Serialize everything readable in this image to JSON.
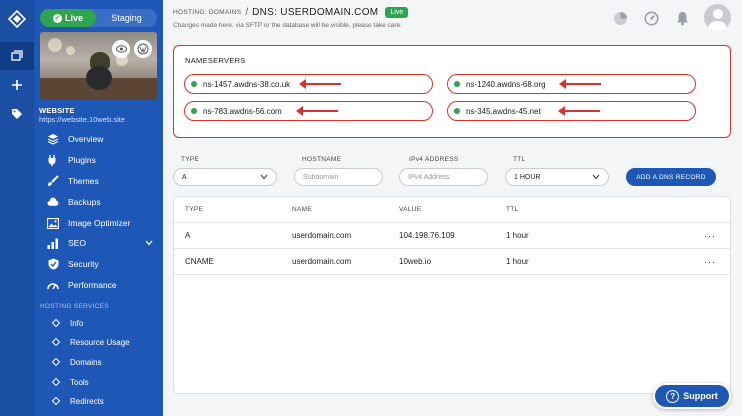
{
  "sidebar": {
    "env_live": "Live",
    "env_staging": "Staging",
    "website_label": "WEBSITE",
    "website_url": "https://website.10web.site",
    "nav": [
      {
        "label": "Overview",
        "icon": "layers-icon"
      },
      {
        "label": "Plugins",
        "icon": "plug-icon"
      },
      {
        "label": "Themes",
        "icon": "brush-icon"
      },
      {
        "label": "Backups",
        "icon": "cloud-icon"
      },
      {
        "label": "Image Optimizer",
        "icon": "image-icon"
      },
      {
        "label": "SEO",
        "icon": "bar-chart-icon"
      },
      {
        "label": "Security",
        "icon": "shield-icon"
      },
      {
        "label": "Performance",
        "icon": "gauge-icon"
      }
    ],
    "hosting_section": "HOSTING SERVICES",
    "hosting": [
      "Info",
      "Resource Usage",
      "Domains",
      "Tools",
      "Redirects"
    ]
  },
  "header": {
    "crumb": "HOSTING: DOMAINS",
    "sep": "/",
    "title": "DNS: USERDOMAIN.COM",
    "badge": "Live",
    "notice": "Changes made here, via SFTP or the database will be visible, please take care."
  },
  "nameservers": {
    "heading": "NAMESERVERS",
    "items": [
      "ns-1457.awdns-38.co.uk",
      "ns-1240.awdns-68.org",
      "ns-783.awdns-56.com",
      "ns-345.awdns-45.net"
    ]
  },
  "form": {
    "type_label": "TYPE",
    "type_value": "A",
    "hostname_label": "HOSTNAME",
    "hostname_placeholder": "Subdomain",
    "ipv4_label": "IPv4 ADDRESS",
    "ipv4_placeholder": "IPv4 Address",
    "ttl_label": "TTL",
    "ttl_value": "1 HOUR",
    "add_button": "ADD A DNS RECORD"
  },
  "table": {
    "headers": [
      "TYPE",
      "NAME",
      "VALUE",
      "TTL"
    ],
    "rows": [
      {
        "type": "A",
        "name": "userdomain.com",
        "value": "104.198.76.109",
        "ttl": "1 hour",
        "more": "···"
      },
      {
        "type": "CNAME",
        "name": "userdomain.com",
        "value": "10web.io",
        "ttl": "1 hour",
        "more": "···"
      }
    ]
  },
  "support": {
    "label": "Support",
    "glyph": "?"
  },
  "colors": {
    "brand": "#1e57b6",
    "live": "#2ea44f",
    "highlight": "#d9342b"
  }
}
